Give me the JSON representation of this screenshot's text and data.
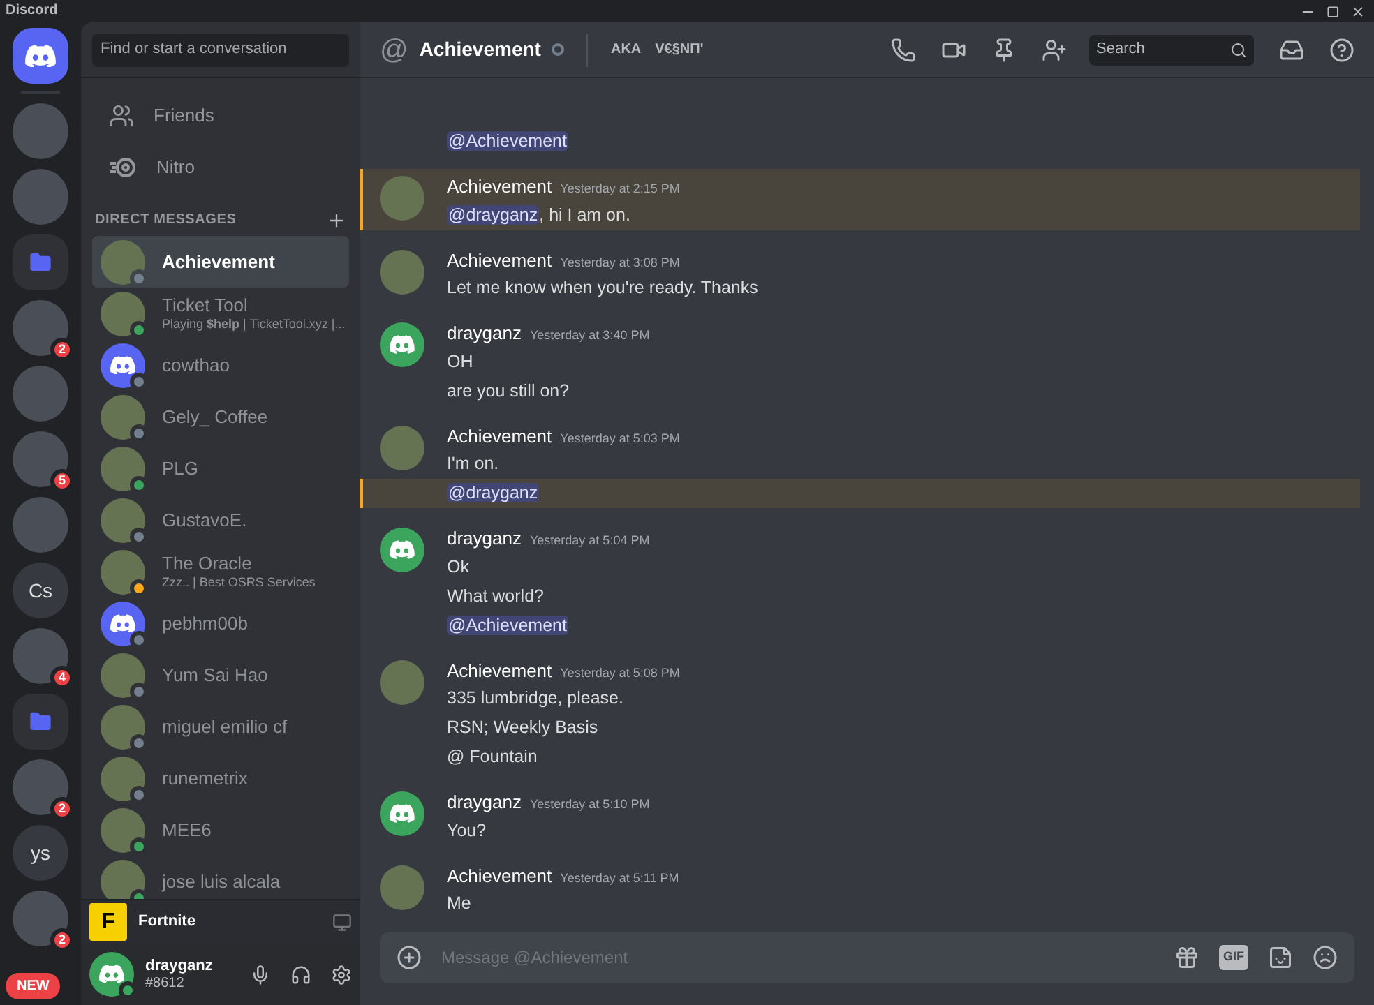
{
  "window": {
    "title": "Discord"
  },
  "servers": [
    {
      "kind": "home"
    },
    {
      "kind": "image"
    },
    {
      "kind": "image"
    },
    {
      "kind": "folder"
    },
    {
      "kind": "image",
      "badge": "2"
    },
    {
      "kind": "image"
    },
    {
      "kind": "image",
      "badge": "5"
    },
    {
      "kind": "image"
    },
    {
      "kind": "text",
      "label": "Cs"
    },
    {
      "kind": "image",
      "badge": "4"
    },
    {
      "kind": "folder"
    },
    {
      "kind": "image",
      "badge": "2"
    },
    {
      "kind": "text",
      "label": "ys"
    },
    {
      "kind": "image",
      "badge": "2"
    }
  ],
  "new_badge": "NEW",
  "dm_sidebar": {
    "search_placeholder": "Find or start a conversation",
    "nav": [
      {
        "kind": "friends",
        "label": "Friends"
      },
      {
        "kind": "nitro",
        "label": "Nitro"
      }
    ],
    "section_title": "DIRECT MESSAGES",
    "conversations": [
      {
        "name": "Achievement",
        "color": "#747f8d",
        "kind": "image",
        "selected": true
      },
      {
        "name": "Ticket Tool",
        "activity": "Playing **$help** | TicketTool.xyz |...",
        "color": "#3ba55d",
        "kind": "image",
        "selected": false
      },
      {
        "name": "cowthao",
        "color": "#747f8d",
        "kind": "discord",
        "selected": false
      },
      {
        "name": "Gely_ Coffee",
        "color": "#747f8d",
        "kind": "image",
        "selected": false
      },
      {
        "name": "PLG",
        "color": "#3ba55d",
        "kind": "image",
        "selected": false
      },
      {
        "name": "GustavoE.",
        "color": "#747f8d",
        "kind": "image",
        "selected": false
      },
      {
        "name": "The Oracle",
        "activity": "Zzz.. | Best OSRS Services",
        "color": "#faa81a",
        "kind": "image",
        "selected": false
      },
      {
        "name": "pebhm00b",
        "color": "#747f8d",
        "kind": "discord",
        "selected": false
      },
      {
        "name": "Yum Sai Hao",
        "color": "#747f8d",
        "kind": "image",
        "selected": false
      },
      {
        "name": "miguel emilio cf",
        "color": "#747f8d",
        "kind": "image",
        "selected": false
      },
      {
        "name": "runemetrix",
        "color": "#747f8d",
        "kind": "image",
        "selected": false
      },
      {
        "name": "MEE6",
        "color": "#3ba55d",
        "kind": "image",
        "selected": false
      },
      {
        "name": "jose luis alcala",
        "color": "#3ba55d",
        "kind": "image",
        "selected": false
      }
    ],
    "activity_bar": {
      "game": "Fortnite",
      "icon_letter": "F"
    },
    "user": {
      "name": "drayganz",
      "tag": "#8612"
    }
  },
  "channel_header": {
    "symbol": "@",
    "name": "Achievement",
    "aka_label": "AKA",
    "aka_name": "V€§ΝΠ'",
    "search_placeholder": "Search"
  },
  "messages": [
    {
      "lines": [
        {
          "highlighted": false,
          "parts": [
            {
              "kind": "mention",
              "text": "@Achievement"
            }
          ]
        }
      ]
    },
    {
      "author": "Achievement",
      "kind": "image",
      "time": "Yesterday at 2:15 PM",
      "lines": [
        {
          "highlighted": true,
          "parts": [
            {
              "kind": "mention",
              "text": "@drayganz"
            },
            {
              "kind": "text",
              "text": ", hi I am on."
            }
          ]
        }
      ]
    },
    {
      "author": "Achievement",
      "kind": "image",
      "time": "Yesterday at 3:08 PM",
      "lines": [
        {
          "highlighted": false,
          "parts": [
            {
              "kind": "text",
              "text": "Let me know when you're ready. Thanks"
            }
          ]
        }
      ]
    },
    {
      "author": "drayganz",
      "kind": "discord",
      "time": "Yesterday at 3:40 PM",
      "lines": [
        {
          "highlighted": false,
          "parts": [
            {
              "kind": "text",
              "text": "OH"
            }
          ]
        },
        {
          "highlighted": false,
          "parts": [
            {
              "kind": "text",
              "text": "are you still on?"
            }
          ]
        }
      ]
    },
    {
      "author": "Achievement",
      "kind": "image",
      "time": "Yesterday at 5:03 PM",
      "lines": [
        {
          "highlighted": false,
          "parts": [
            {
              "kind": "text",
              "text": "I'm on."
            }
          ]
        },
        {
          "highlighted": true,
          "parts": [
            {
              "kind": "mention",
              "text": "@drayganz"
            }
          ]
        }
      ]
    },
    {
      "author": "drayganz",
      "kind": "discord",
      "time": "Yesterday at 5:04 PM",
      "lines": [
        {
          "highlighted": false,
          "parts": [
            {
              "kind": "text",
              "text": "Ok"
            }
          ]
        },
        {
          "highlighted": false,
          "parts": [
            {
              "kind": "text",
              "text": "What world?"
            }
          ]
        },
        {
          "highlighted": false,
          "parts": [
            {
              "kind": "mention",
              "text": "@Achievement"
            }
          ]
        }
      ]
    },
    {
      "author": "Achievement",
      "kind": "image",
      "time": "Yesterday at 5:08 PM",
      "lines": [
        {
          "highlighted": false,
          "parts": [
            {
              "kind": "text",
              "text": "335 lumbridge, please."
            }
          ]
        },
        {
          "highlighted": false,
          "parts": [
            {
              "kind": "text",
              "text": "RSN; Weekly Basis"
            }
          ]
        },
        {
          "highlighted": false,
          "parts": [
            {
              "kind": "text",
              "text": "@ Fountain"
            }
          ]
        }
      ]
    },
    {
      "author": "drayganz",
      "kind": "discord",
      "time": "Yesterday at 5:10 PM",
      "lines": [
        {
          "highlighted": false,
          "parts": [
            {
              "kind": "text",
              "text": "You?"
            }
          ]
        }
      ]
    },
    {
      "author": "Achievement",
      "kind": "image",
      "time": "Yesterday at 5:11 PM",
      "lines": [
        {
          "highlighted": false,
          "parts": [
            {
              "kind": "text",
              "text": "Me"
            }
          ]
        }
      ]
    }
  ],
  "composer": {
    "placeholder": "Message @Achievement",
    "gif_label": "GIF"
  }
}
